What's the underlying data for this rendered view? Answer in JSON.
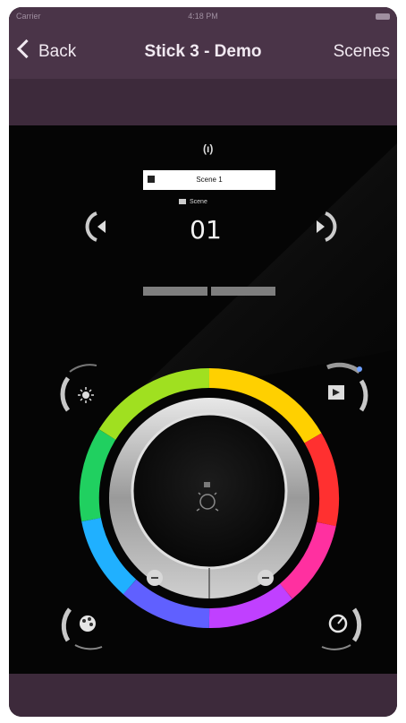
{
  "status_bar": {
    "carrier": "Carrier",
    "time": "4:18 PM"
  },
  "nav": {
    "back_label": "Back",
    "title": "Stick 3 - Demo",
    "right_label": "Scenes"
  },
  "scene": {
    "top_indicator": "(ı)",
    "name": "Scene 1",
    "type_label": "Scene",
    "number": "01"
  },
  "icons": {
    "back": "chevron-left-icon",
    "prev_scene": "previous-arrow-icon",
    "next_scene": "next-arrow-icon",
    "dimmer": "brightness-icon",
    "scene_mode": "play-scene-icon",
    "color_palette": "palette-icon",
    "speed": "speed-dial-icon",
    "center": "light-bulb-icon"
  },
  "colors": {
    "nav_bg": "#4a3448",
    "sub_bg": "#3d2a3b",
    "screen_bg": "#050505",
    "accent": "#6fa0ff"
  }
}
